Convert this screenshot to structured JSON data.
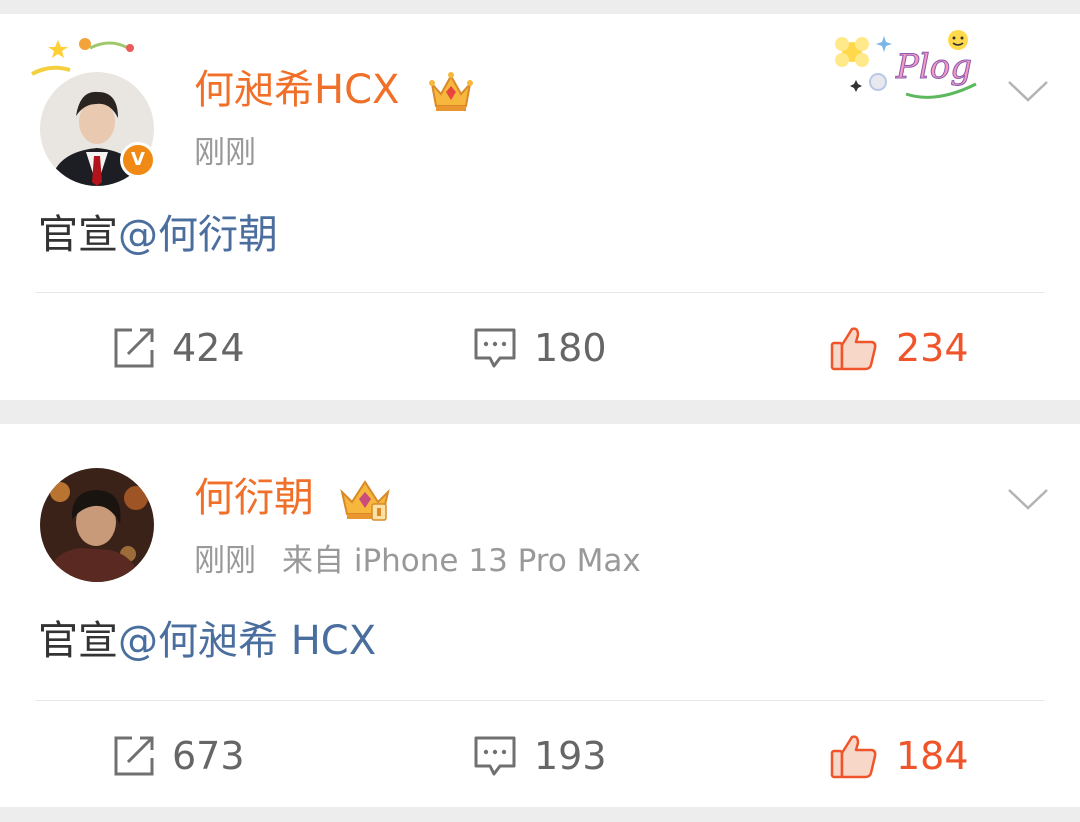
{
  "posts": [
    {
      "username": "何昶希HCX",
      "time": "刚刚",
      "source": "",
      "verified_mark": "V",
      "content": {
        "prefix": "官宣",
        "mention": "@何衍朝"
      },
      "sticker": "Plog",
      "stats": {
        "reposts": "424",
        "comments": "180",
        "likes": "234"
      },
      "liked": true
    },
    {
      "username": "何衍朝",
      "time": "刚刚",
      "source": "来自 iPhone 13 Pro Max",
      "content": {
        "prefix": "官宣",
        "mention": "@何昶希 HCX"
      },
      "stats": {
        "reposts": "673",
        "comments": "193",
        "likes": "184"
      },
      "liked": true
    }
  ],
  "colors": {
    "username": "#f0702a",
    "mention": "#4a6e9e",
    "meta": "#999999",
    "like_active": "#f0542a",
    "background": "#ededed"
  },
  "icons": {
    "repost": "repost-icon",
    "comment": "comment-icon",
    "like": "thumbs-up-icon",
    "more": "chevron-down-icon",
    "crown": "crown-badge-icon"
  }
}
